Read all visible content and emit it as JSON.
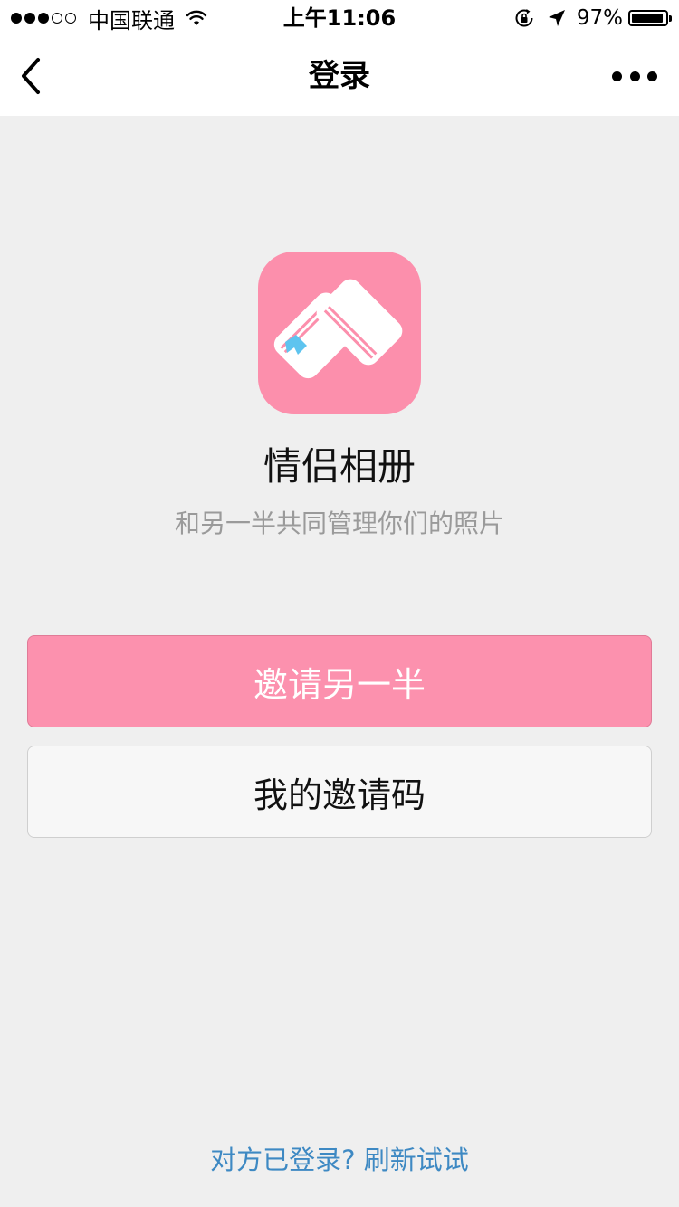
{
  "status_bar": {
    "signal_strength": "3/5",
    "carrier": "中国联通",
    "time": "上午11:06",
    "battery_percent": "97%",
    "icons": [
      "signal-dots-icon",
      "wifi-icon",
      "orientation-lock-icon",
      "location-arrow-icon",
      "battery-icon"
    ]
  },
  "navbar": {
    "title": "登录",
    "back_icon": "chevron-left-icon",
    "more_icon": "more-dots-icon"
  },
  "app": {
    "name": "情侣相册",
    "description": "和另一半共同管理你们的照片",
    "icon": "heart-book-app-icon"
  },
  "buttons": {
    "invite_label": "邀请另一半",
    "my_code_label": "我的邀请码"
  },
  "footer": {
    "question": "对方已登录?",
    "refresh_label": "刷新试试"
  },
  "colors": {
    "accent_pink": "#fc8fac",
    "link_blue": "#3e89c3",
    "background": "#efefef"
  }
}
